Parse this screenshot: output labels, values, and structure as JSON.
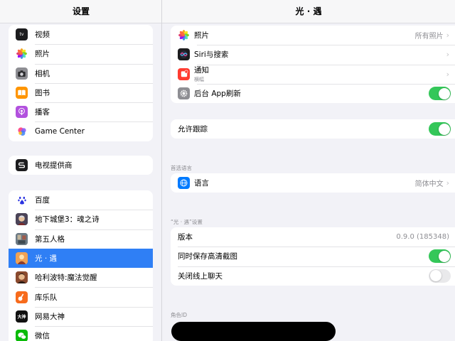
{
  "sidebar": {
    "title": "设置",
    "group1": [
      {
        "label": "视频",
        "icon": "apple-tv-icon",
        "color": "#1c1c1e",
        "glyph": "tv"
      },
      {
        "label": "照片",
        "icon": "photos-icon",
        "color": "#ffffff",
        "glyph": "✿"
      },
      {
        "label": "相机",
        "icon": "camera-icon",
        "color": "#8e8e93",
        "glyph": "◉"
      },
      {
        "label": "图书",
        "icon": "books-icon",
        "color": "#ff9500",
        "glyph": "▮"
      },
      {
        "label": "播客",
        "icon": "podcasts-icon",
        "color": "#b251de",
        "glyph": "◎"
      },
      {
        "label": "Game Center",
        "icon": "game-center-icon",
        "color": "#ffffff",
        "glyph": "●"
      }
    ],
    "group2": [
      {
        "label": "电视提供商",
        "icon": "tv-provider-icon",
        "color": "#1c1c1e",
        "glyph": "S"
      }
    ],
    "group3": [
      {
        "label": "百度",
        "icon": "baidu-icon",
        "color": "#ffffff",
        "glyph": "🐾"
      },
      {
        "label": "地下城堡3：魂之诗",
        "icon": "dungeon-castle-icon",
        "color": "#3a3a46",
        "glyph": "▲"
      },
      {
        "label": "第五人格",
        "icon": "identity-v-icon",
        "color": "#5e6b74",
        "glyph": "☗"
      },
      {
        "label": "光 · 遇",
        "icon": "sky-icon",
        "color": "#e88a42",
        "glyph": "✦"
      },
      {
        "label": "哈利波特:魔法觉醒",
        "icon": "harry-potter-icon",
        "color": "#7a3b2a",
        "glyph": "⚡"
      },
      {
        "label": "库乐队",
        "icon": "garageband-icon",
        "color": "#f76b1c",
        "glyph": "♪"
      },
      {
        "label": "网易大神",
        "icon": "netease-dashen-icon",
        "color": "#111111",
        "glyph": "大神"
      },
      {
        "label": "微信",
        "icon": "wechat-icon",
        "color": "#09bb07",
        "glyph": "✉"
      }
    ]
  },
  "main": {
    "title": "光 · 遇",
    "photos": {
      "label": "照片",
      "value": "所有照片"
    },
    "siri": {
      "label": "Siri与搜索"
    },
    "notifications": {
      "label": "通知",
      "sub": "横幅"
    },
    "background_refresh": {
      "label": "后台 App刷新",
      "on": true
    },
    "tracking": {
      "label": "允许跟踪",
      "on": true
    },
    "language_section": "首选语言",
    "language": {
      "label": "语言",
      "value": "简体中文"
    },
    "app_section": "“光 · 遇”设置",
    "version": {
      "label": "版本",
      "value": "0.9.0 (185348)"
    },
    "save_hd": {
      "label": "同时保存高清截图",
      "on": true
    },
    "close_chat": {
      "label": "关闭线上聊天",
      "on": false
    },
    "role_section": "角色ID"
  },
  "colors": {
    "accent": "#2f7ff5",
    "toggle_on": "#34c759",
    "toggle_off": "#e9e9eb",
    "background": "#f2f2f7"
  }
}
